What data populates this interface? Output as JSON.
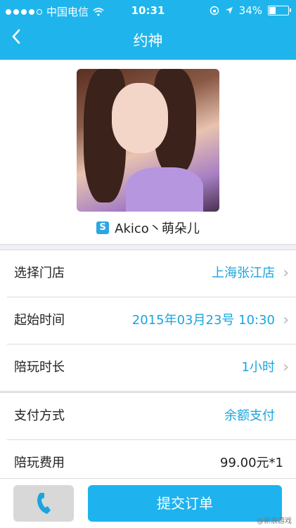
{
  "status_bar": {
    "carrier": "中国电信",
    "time": "10:31",
    "battery": "34%"
  },
  "nav": {
    "title": "约神",
    "back_icon": "chevron-left-icon"
  },
  "profile": {
    "badge": "S",
    "name": "Akico丶萌朵儿"
  },
  "order_rows": [
    {
      "label": "选择门店",
      "value": "上海张江店"
    },
    {
      "label": "起始时间",
      "value": "2015年03月23号 10:30"
    },
    {
      "label": "陪玩时长",
      "value": "1小时"
    }
  ],
  "payment": {
    "method_label": "支付方式",
    "method_value": "余额支付",
    "fee_label": "陪玩费用",
    "fee_value": "99.00元*1"
  },
  "actions": {
    "submit": "提交订单",
    "phone_icon": "phone-icon"
  },
  "watermark": "@新浪游戏",
  "colors": {
    "accent": "#1fb5ec",
    "link": "#1aa5de"
  }
}
